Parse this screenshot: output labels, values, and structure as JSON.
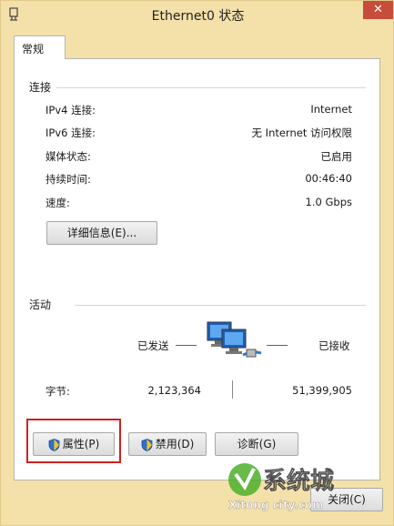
{
  "window": {
    "title": "Ethernet0 状态",
    "close_glyph": "✕"
  },
  "tabs": [
    {
      "label": "常规"
    }
  ],
  "connection": {
    "header": "连接",
    "rows": [
      {
        "label": "IPv4 连接:",
        "value": "Internet"
      },
      {
        "label": "IPv6 连接:",
        "value": "无 Internet 访问权限"
      },
      {
        "label": "媒体状态:",
        "value": "已启用"
      },
      {
        "label": "持续时间:",
        "value": "00:46:40"
      },
      {
        "label": "速度:",
        "value": "1.0 Gbps"
      }
    ],
    "details_button": "详细信息(E)..."
  },
  "activity": {
    "header": "活动",
    "sent_label": "已发送",
    "received_label": "已接收",
    "bytes_label": "字节:",
    "bytes_sent": "2,123,364",
    "bytes_received": "51,399,905"
  },
  "buttons": {
    "properties": "属性(P)",
    "disable": "禁用(D)",
    "diagnose": "诊断(G)",
    "close": "关闭(C)"
  },
  "watermark": {
    "brand": "系统城",
    "url": "xitongcity.com"
  },
  "colors": {
    "window_bg": "#f4e0a9",
    "panel_bg": "#ffffff",
    "close_bg": "#c74c3c",
    "highlight": "#d02020"
  },
  "icons": [
    "network-adapter-icon",
    "network-activity-icon",
    "shield-icon"
  ]
}
